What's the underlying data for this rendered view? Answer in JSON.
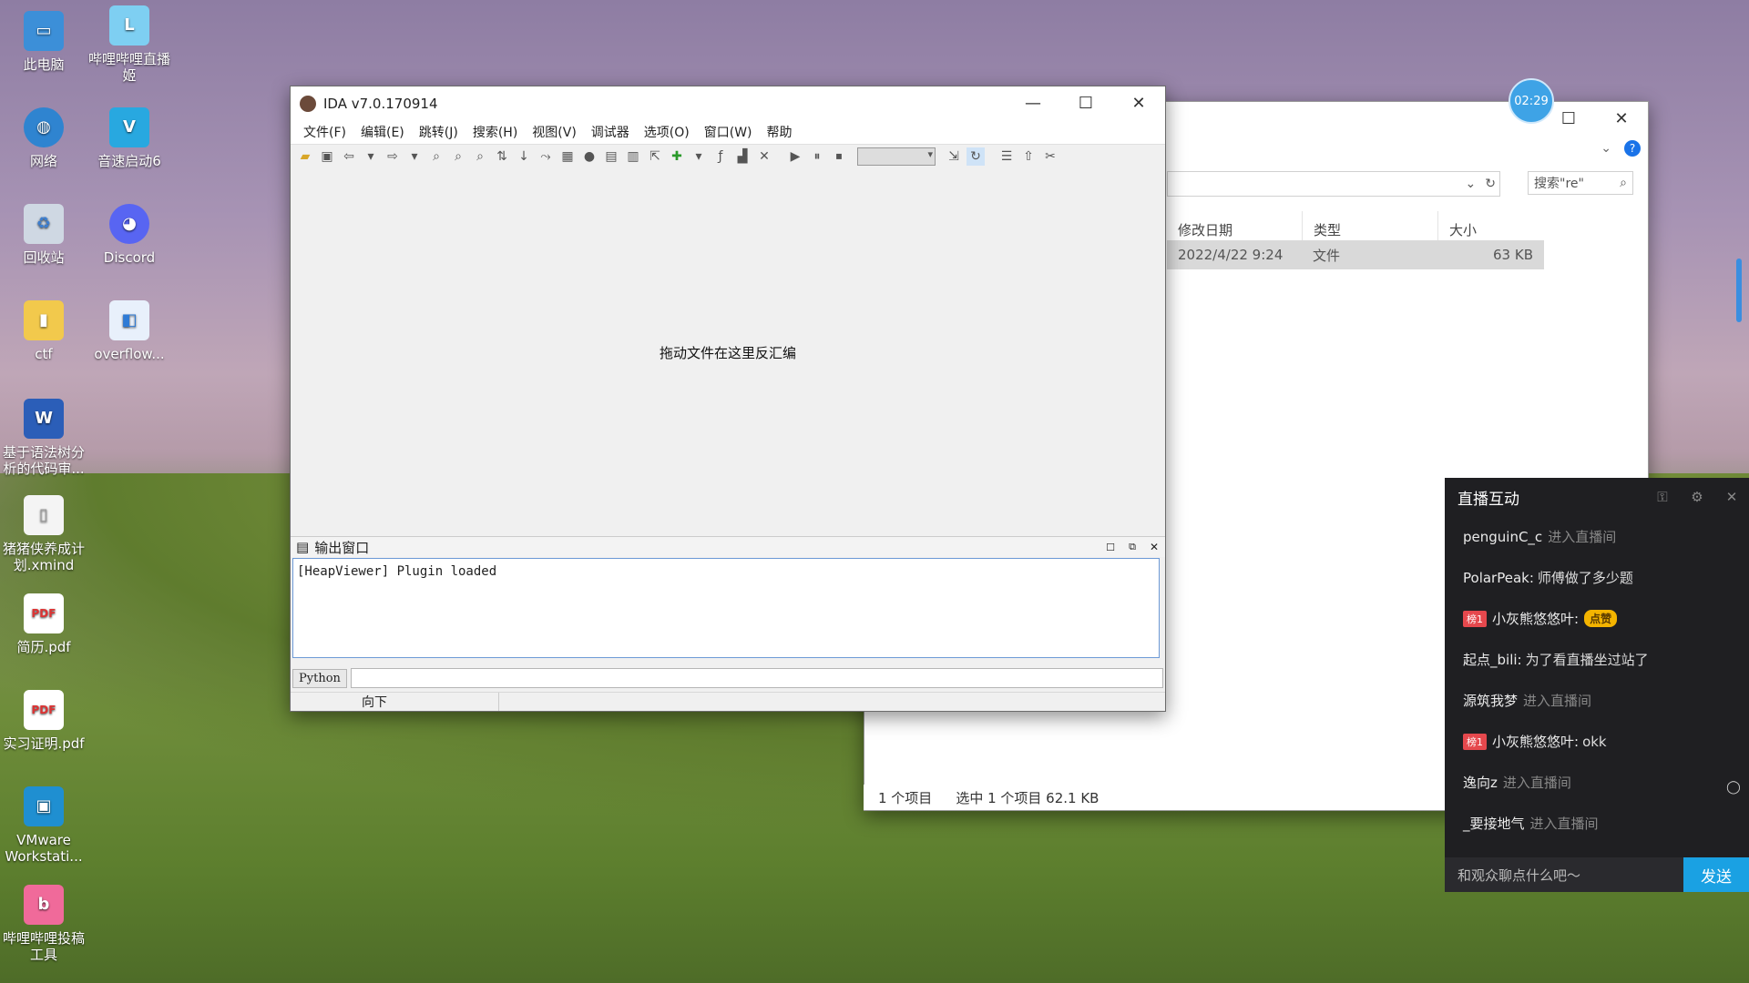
{
  "desktop": {
    "icons": [
      {
        "label": "此电脑"
      },
      {
        "label": "哔哩哔哩直播姬"
      },
      {
        "label": "网络"
      },
      {
        "label": "音速启动6"
      },
      {
        "label": "回收站"
      },
      {
        "label": "Discord"
      },
      {
        "label": "ctf"
      },
      {
        "label": "overflow..."
      },
      {
        "label": "基于语法树分析的代码审..."
      },
      {
        "label": "猪猪侠养成计划.xmind"
      },
      {
        "label": "简历.pdf"
      },
      {
        "label": "实习证明.pdf"
      },
      {
        "label": "VMware Workstati..."
      },
      {
        "label": "哔哩哔哩投稿工具"
      }
    ]
  },
  "ida": {
    "title": "IDA v7.0.170914",
    "menu": [
      "文件(F)",
      "编辑(E)",
      "跳转(J)",
      "搜索(H)",
      "视图(V)",
      "调试器",
      "选项(O)",
      "窗口(W)",
      "帮助"
    ],
    "drop_hint": "拖动文件在这里反汇编",
    "output_title": "输出窗口",
    "output_text": "[HeapViewer] Plugin loaded",
    "python_label": "Python",
    "status": "向下"
  },
  "explorer": {
    "search_placeholder": "搜索\"re\"",
    "columns": [
      "修改日期",
      "类型",
      "大小"
    ],
    "row": {
      "date": "2022/4/22 9:24",
      "type": "文件",
      "size": "63 KB"
    },
    "status": [
      "1 个项目",
      "选中 1 个项目  62.1 KB"
    ]
  },
  "clock": "02:29",
  "live": {
    "title": "直播互动",
    "items": [
      {
        "user": "penguinC_c",
        "text": "进入直播间",
        "kind": "enter"
      },
      {
        "user": "PolarPeak:",
        "text": "师傅做了多少题",
        "kind": "msg"
      },
      {
        "user": "小灰熊悠悠叶:",
        "text": "",
        "kind": "badge",
        "badge": "榜1",
        "extra": "点赞"
      },
      {
        "user": "起点_bili:",
        "text": "为了看直播坐过站了",
        "kind": "msg"
      },
      {
        "user": "源筑我梦",
        "text": "进入直播间",
        "kind": "enter"
      },
      {
        "user": "小灰熊悠悠叶:",
        "text": "okk",
        "kind": "badge",
        "badge": "榜1"
      },
      {
        "user": "逸向z",
        "text": "进入直播间",
        "kind": "enter"
      },
      {
        "user": "_要接地气",
        "text": "进入直播间",
        "kind": "enter"
      }
    ],
    "input_placeholder": "和观众聊点什么吧～",
    "send_label": "发送"
  }
}
